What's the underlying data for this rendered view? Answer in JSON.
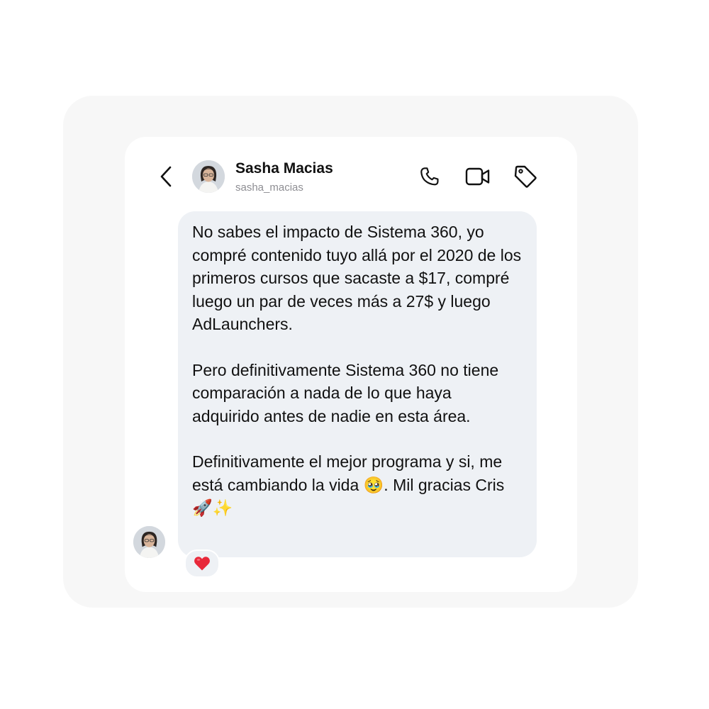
{
  "contact": {
    "name": "Sasha Macias",
    "username": "sasha_macias"
  },
  "header_icons": [
    "back-chevron-icon",
    "phone-icon",
    "video-camera-icon",
    "tag-icon"
  ],
  "message": {
    "paragraphs": [
      "No sabes el impacto de Sistema 360, yo compré contenido tuyo allá por el 2020 de los primeros cursos que sacaste a $17, compré luego un par de veces más a 27$ y luego AdLaunchers.",
      "Pero definitivamente Sistema 360 no tiene comparación a nada de lo que haya adquirido antes de nadie en esta área.",
      "Definitivamente el mejor programa y si, me está cambiando la vida 🥹. Mil gracias Cris 🚀✨"
    ],
    "reaction": "❤️"
  },
  "colors": {
    "page_background": "#ffffff",
    "outer_frame": "#f7f7f7",
    "card": "#ffffff",
    "bubble": "#eef1f5",
    "text": "#111111",
    "secondary_text": "#8e8e93",
    "reaction_heart": "#e8283a"
  }
}
